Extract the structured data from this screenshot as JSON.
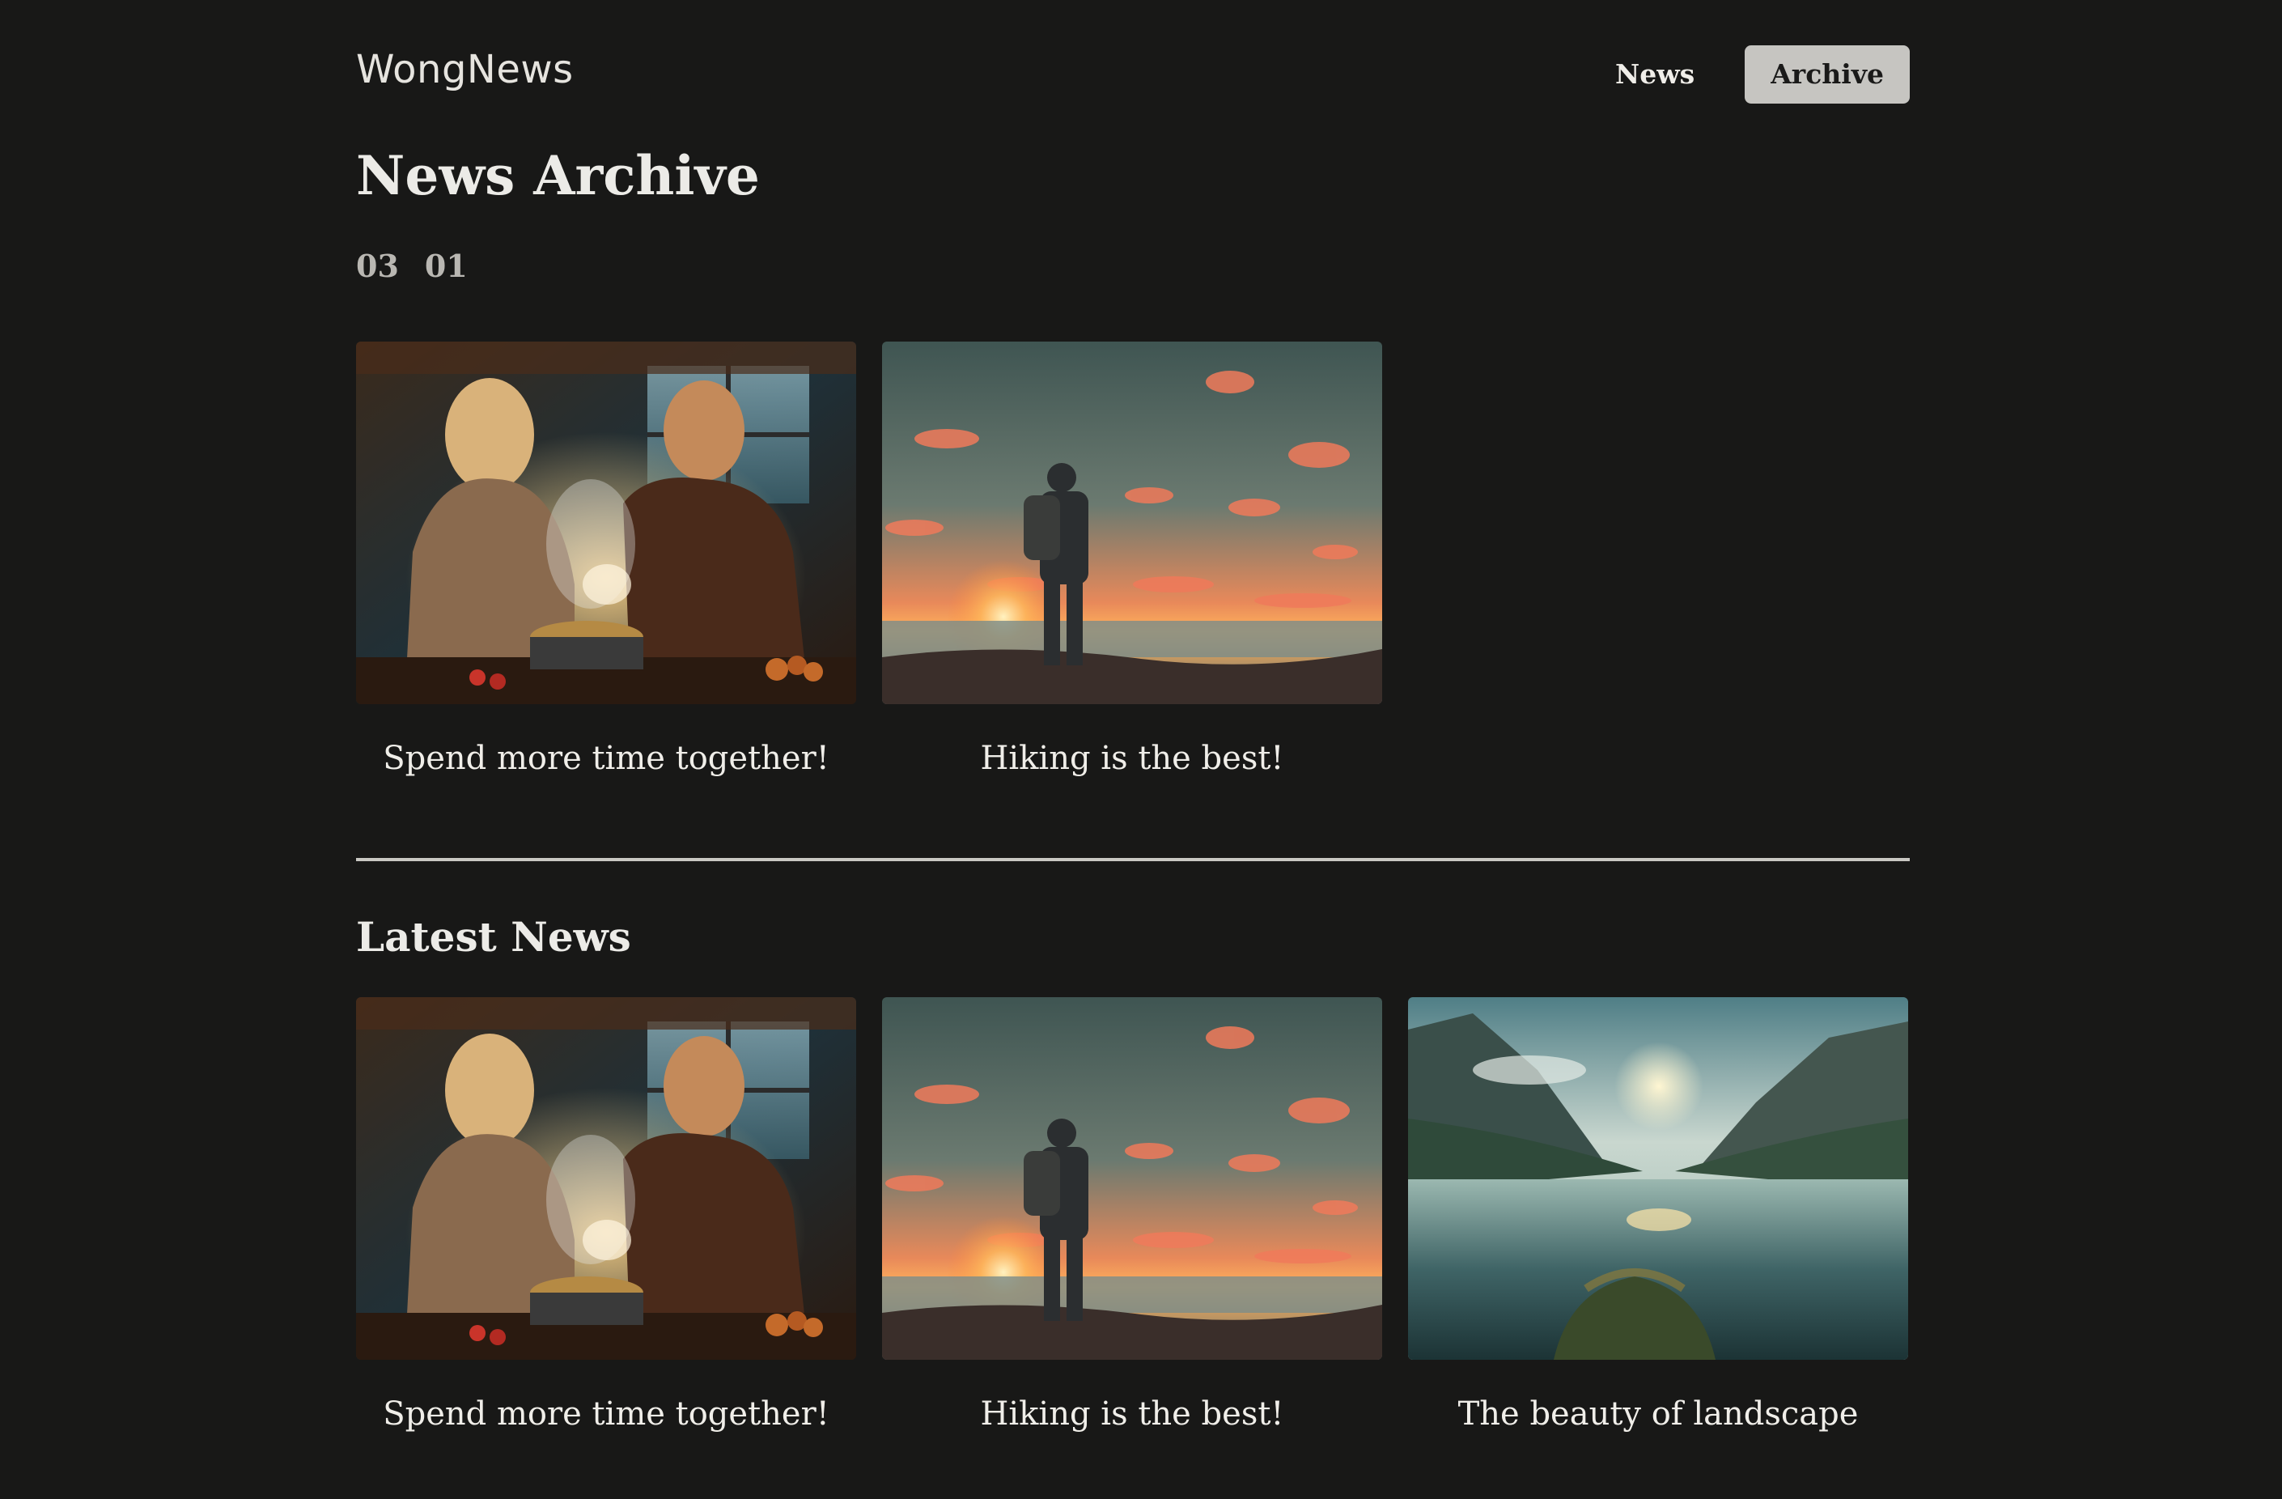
{
  "header": {
    "logo": "WongNews",
    "nav": [
      {
        "label": "News",
        "active": false
      },
      {
        "label": "Archive",
        "active": true
      }
    ]
  },
  "archive": {
    "title": "News Archive",
    "filters": [
      "03",
      "01"
    ],
    "articles": [
      {
        "title": "Spend more time together!",
        "image": "couple-cooking-image"
      },
      {
        "title": "Hiking is the best!",
        "image": "hiker-sunset-image"
      }
    ]
  },
  "latest": {
    "title": "Latest News",
    "articles": [
      {
        "title": "Spend more time together!",
        "image": "couple-cooking-image"
      },
      {
        "title": "Hiking is the best!",
        "image": "hiker-sunset-image"
      },
      {
        "title": "The beauty of landscape",
        "image": "mountain-lake-image"
      }
    ]
  },
  "colors": {
    "background": "#181817",
    "text": "#e8e6e1",
    "active_nav_bg": "#c6c5c1"
  }
}
